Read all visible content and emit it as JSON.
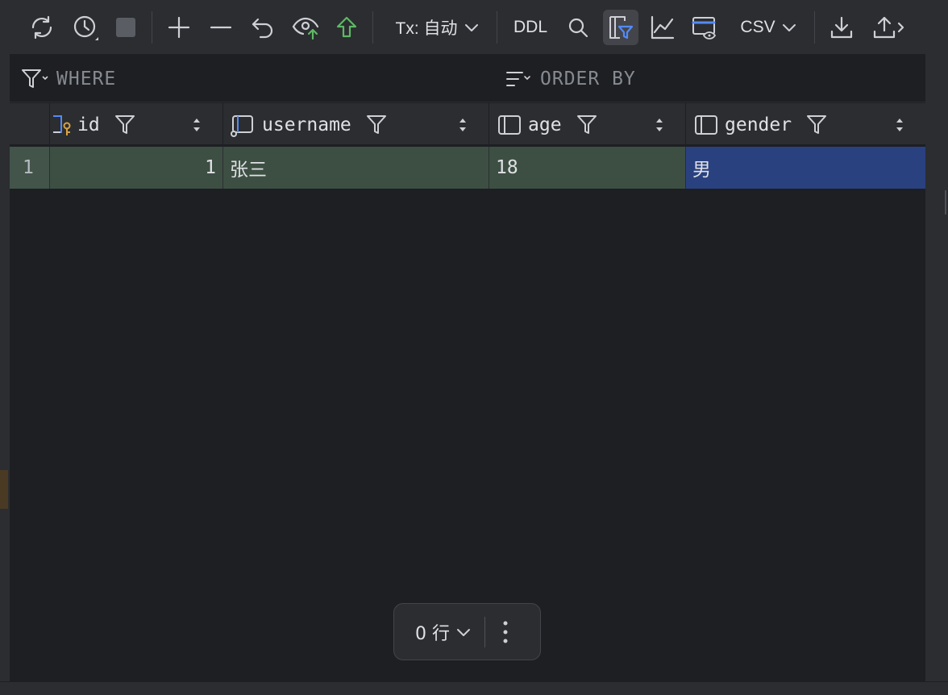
{
  "toolbar": {
    "tx_label": "Tx: 自动",
    "ddl_label": "DDL",
    "export_format": "CSV"
  },
  "filters": {
    "where_label": "WHERE",
    "order_by_label": "ORDER BY"
  },
  "columns": [
    {
      "name": "id",
      "kind": "primary-key"
    },
    {
      "name": "username",
      "kind": "column"
    },
    {
      "name": "age",
      "kind": "column"
    },
    {
      "name": "gender",
      "kind": "column"
    }
  ],
  "rows": [
    {
      "index": "1",
      "id": "1",
      "username": "张三",
      "age": "18",
      "gender": "男"
    }
  ],
  "footer": {
    "row_count_label": "0 行"
  },
  "colors": {
    "modified_cell": "#3d4f43",
    "selected_cell": "#2a4180",
    "accent_blue": "#548af7",
    "accent_green": "#5fb865",
    "key_yellow": "#d9a343"
  }
}
